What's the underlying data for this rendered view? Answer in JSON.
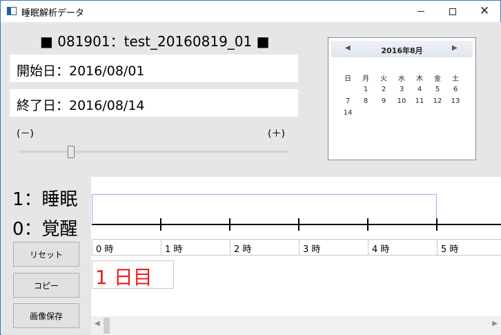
{
  "window": {
    "title": "睡眠解析データ",
    "minimize_glyph": "",
    "close_glyph": "✕"
  },
  "header": {
    "id_label": "■ 081901：test_20160819_01 ■"
  },
  "dates": {
    "start": "開始日：2016/08/01",
    "end": "終了日：2016/08/14"
  },
  "slider": {
    "minus_label": "(－)",
    "plus_label": "(＋)",
    "position_fraction": 0.18
  },
  "calendar": {
    "prev": "◀",
    "next": "▶",
    "title": "2016年8月",
    "weekdays": [
      "日",
      "月",
      "火",
      "水",
      "木",
      "金",
      "土"
    ],
    "weeks": [
      [
        "",
        "1",
        "2",
        "3",
        "4",
        "5",
        "6"
      ],
      [
        "7",
        "8",
        "9",
        "10",
        "11",
        "12",
        "13"
      ],
      [
        "14",
        "",
        "",
        "",
        "",
        "",
        ""
      ]
    ]
  },
  "chart": {
    "sleep_label": "1：睡眠",
    "wake_label": "0：覚醒",
    "hours": [
      "0 時",
      "1 時",
      "2 時",
      "3 時",
      "4 時",
      "5 時"
    ],
    "day_label": "1 日目",
    "day_color": "#ee1c1c"
  },
  "buttons": {
    "reset": "リセット",
    "copy": "コピー",
    "save_image": "画像保存"
  },
  "scrollbar": {
    "left_arrow": "◀",
    "right_arrow": "▶"
  }
}
